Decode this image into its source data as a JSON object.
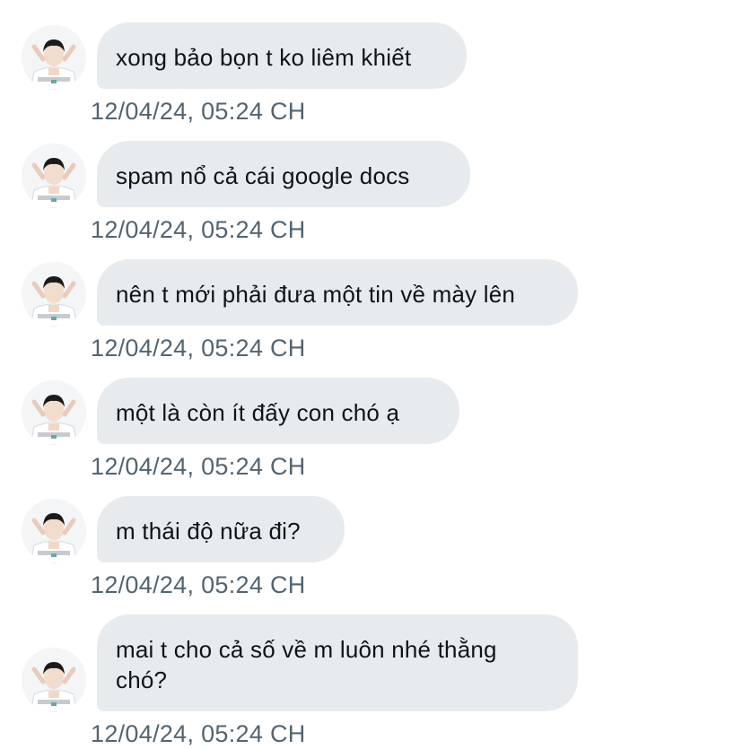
{
  "messages": [
    {
      "text": "xong bảo bọn t ko liêm khiết",
      "time": "12/04/24, 05:24 CH"
    },
    {
      "text": "spam nổ cả cái google docs",
      "time": "12/04/24, 05:24 CH"
    },
    {
      "text": "nên t mới phải đưa một tin về mày lên",
      "time": "12/04/24, 05:24 CH"
    },
    {
      "text": "một là còn ít đấy con chó ạ",
      "time": "12/04/24, 05:24 CH"
    },
    {
      "text": "m thái độ nữa đi?",
      "time": "12/04/24, 05:24 CH"
    },
    {
      "text": "mai t cho cả số về m luôn nhé thằng\nchó?",
      "time": "12/04/24, 05:24 CH"
    }
  ],
  "colors": {
    "bubble": "#e8ebee",
    "text": "#0f1419",
    "timestamp": "#536471"
  },
  "avatar_icon": "user-avatar-photo"
}
